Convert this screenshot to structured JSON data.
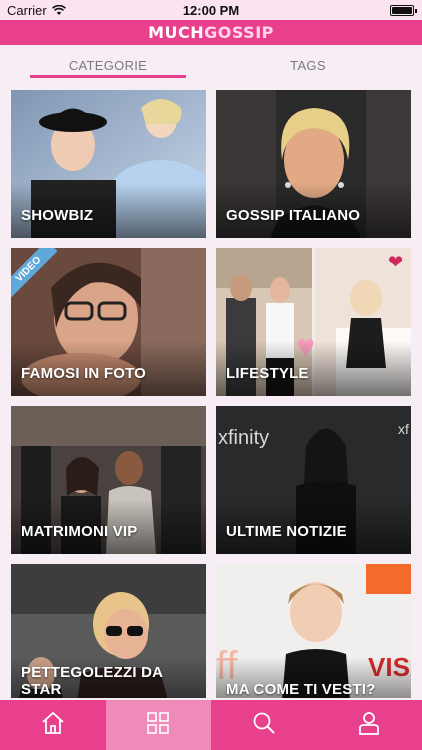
{
  "status_bar": {
    "carrier": "Carrier",
    "time": "12:00 PM"
  },
  "header": {
    "logo_part1": "MUCH",
    "logo_part2": "GOSSIP"
  },
  "tabs": [
    {
      "label": "CATEGORIE",
      "active": true
    },
    {
      "label": "TAGS",
      "active": false
    }
  ],
  "categories": [
    {
      "label": "SHOWBIZ"
    },
    {
      "label": "GOSSIP ITALIANO"
    },
    {
      "label": "FAMOSI IN FOTO",
      "badge": "VIDEO"
    },
    {
      "label": "LIFESTYLE"
    },
    {
      "label": "MATRIMONI VIP"
    },
    {
      "label": "ULTIME NOTIZIE"
    },
    {
      "label": "PETTEGOLEZZI DA STAR"
    },
    {
      "label": "MA COME TI VESTI?"
    }
  ],
  "bottom_nav": [
    {
      "icon": "home-icon",
      "active": false
    },
    {
      "icon": "grid-icon",
      "active": true
    },
    {
      "icon": "search-icon",
      "active": false
    },
    {
      "icon": "user-icon",
      "active": false
    }
  ],
  "colors": {
    "brand_pink": "#e8408c",
    "active_nav": "#f08ab8",
    "status_bg": "#fbe3ef"
  }
}
